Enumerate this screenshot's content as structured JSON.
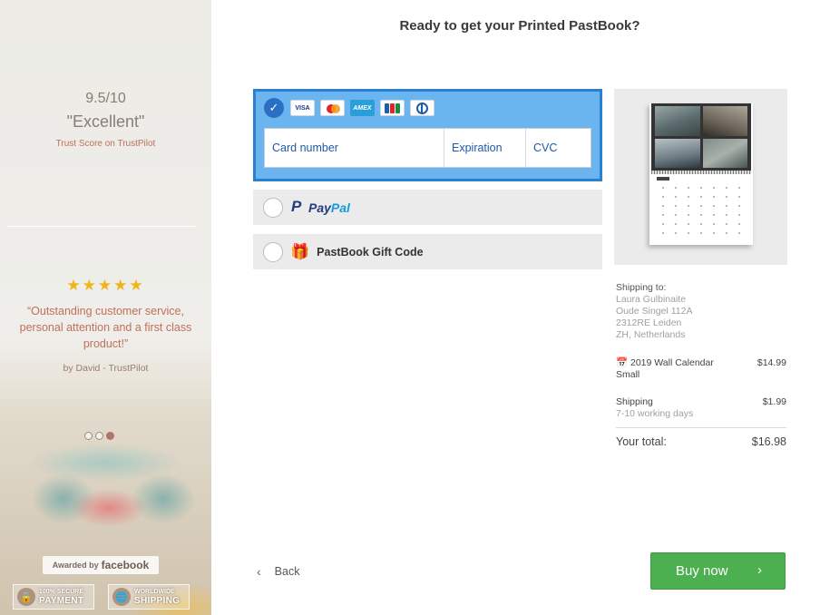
{
  "sidebar": {
    "score_value": "9.5/10",
    "score_label": "\"Excellent\"",
    "score_caption": "Trust Score on TrustPilot",
    "stars": "★★★★★",
    "quote": "“Outstanding customer service, personal attention and a first class product!”",
    "quote_author": "by David - TrustPilot",
    "carousel_active_index": 3,
    "badge_awarded_prefix": "Awarded by",
    "badge_awarded_brand": "facebook",
    "badge_secure_top": "100% SECURE",
    "badge_secure_bottom": "PAYMENT",
    "badge_shipping_top": "WORLDWIDE",
    "badge_shipping_bottom": "SHIPPING"
  },
  "page": {
    "title": "Ready to get your Printed PastBook?"
  },
  "payment": {
    "card": {
      "selected": true,
      "logos": [
        "VISA",
        "mastercard",
        "AMEX",
        "JCB",
        "Diners Club"
      ],
      "visa_text": "VISA",
      "amex_text": "AMEX",
      "number_placeholder": "Card number",
      "expiration_placeholder": "Expiration",
      "cvc_placeholder": "CVC"
    },
    "paypal": {
      "pay": "Pay",
      "pal": "Pal",
      "selected": false
    },
    "gift": {
      "label": "PastBook Gift Code",
      "selected": false
    }
  },
  "summary": {
    "shipping_to_label": "Shipping to:",
    "address": [
      "Laura Gulbinaite",
      "Oude Singel 112A",
      "2312RE Leiden",
      "ZH, Netherlands"
    ],
    "item_name": "2019 Wall Calendar Small",
    "item_icon": "calendar-icon",
    "item_price": "$14.99",
    "shipping_label": "Shipping",
    "shipping_time": "7-10 working days",
    "shipping_price": "$1.99",
    "total_label": "Your total:",
    "total_amount": "$16.98"
  },
  "actions": {
    "back_label": "Back",
    "buy_label": "Buy now"
  },
  "colors": {
    "card_selected_bg": "#6ab4ef",
    "card_selected_border": "#2b7fd3",
    "buy_button": "#4caf50",
    "stars": "#f0b418"
  }
}
